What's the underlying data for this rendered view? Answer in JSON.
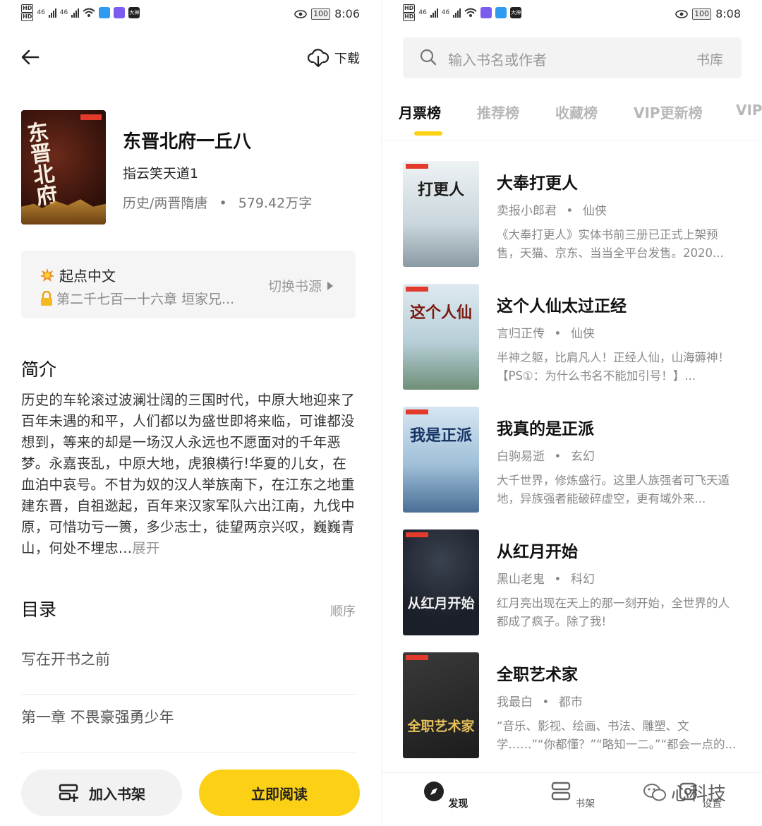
{
  "status_left": {
    "hd1": "HD",
    "hd2": "HD",
    "net1": "46",
    "net2": "46",
    "app_tag": "大神"
  },
  "status_right_left": {
    "battery": "100",
    "time": "8:06"
  },
  "status_right_right": {
    "battery": "100",
    "time": "8:08"
  },
  "detail": {
    "download_label": "下载",
    "cover_title": "东晋北府",
    "book_title": "东晋北府一丘八",
    "author": "指云笑天道1",
    "category": "历史/两晋隋唐",
    "separator": "•",
    "word_count": "579.42万字",
    "source": {
      "name": "起点中文",
      "chapter": "第二千七百一十六章 垣家兄...",
      "switch_label": "切换书源"
    },
    "intro_heading": "简介",
    "intro_text": "历史的车轮滚过波澜壮阔的三国时代，中原大地迎来了百年未遇的和平，人们都以为盛世即将来临，可谁都没想到，等来的却是一场汉人永远也不愿面对的千年恶梦。永嘉丧乱，中原大地，虎狼横行!华夏的儿女，在血泊中哀号。不甘为奴的汉人举族南下，在江东之地重建东晋，自祖逖起，百年来汉家军队六出江南，九伐中原，可惜功亏一篑，多少志士，徒望两京兴叹，巍巍青山，何处不埋忠...",
    "intro_more": "展开",
    "toc_heading": "目录",
    "toc_order": "顺序",
    "toc_items": [
      "写在开书之前",
      "第一章 不畏豪强勇少年"
    ],
    "add_shelf_label": "加入书架",
    "read_now_label": "立即阅读"
  },
  "discover": {
    "search_placeholder": "输入书名或作者",
    "library_label": "书库",
    "tabs": [
      "月票榜",
      "推荐榜",
      "收藏榜",
      "VIP更新榜",
      "VIP"
    ],
    "active_tab": "月票榜",
    "books": [
      {
        "cover_text": "打更人",
        "title": "大奉打更人",
        "author": "卖报小郎君",
        "genre": "仙侠",
        "desc": "《大奉打更人》实体书前三册已正式上架预售，天猫、京东、当当全平台发售。2020...",
        "cover_bg": "#dfe7ec",
        "cover_fg": "#1b1b1b"
      },
      {
        "cover_text": "这个人仙",
        "title": "这个人仙太过正经",
        "author": "言归正传",
        "genre": "仙侠",
        "desc": "半神之躯，比肩凡人！正经人仙，山海薅神！【PS①：为什么书名不能加引号！】...",
        "cover_bg": "#cfe0e8",
        "cover_fg": "#8a1a12"
      },
      {
        "cover_text": "我是正派",
        "title": "我真的是正派",
        "author": "白驹易逝",
        "genre": "玄幻",
        "desc": "大千世界，修炼盛行。这里人族强者可飞天遁地，异族强者能破碎虚空，更有域外来...",
        "cover_bg": "#b9d3e6",
        "cover_fg": "#183a6e"
      },
      {
        "cover_text": "从红月开始",
        "title": "从红月开始",
        "author": "黑山老鬼",
        "genre": "科幻",
        "desc": "红月亮出现在天上的那一刻开始，全世界的人都成了疯子。除了我!",
        "cover_bg": "#1e2430",
        "cover_fg": "#f2f2f2"
      },
      {
        "cover_text": "全职艺术家",
        "title": "全职艺术家",
        "author": "我最白",
        "genre": "都市",
        "desc": "“音乐、影视、绘画、书法、雕塑、文学……”“你都懂？”“略知一二。”“都会一点的...",
        "cover_bg": "#2b2b2b",
        "cover_fg": "#e8c15a"
      }
    ],
    "nav": [
      "发现",
      "书架",
      "设置"
    ],
    "watermark": "心科技"
  },
  "colors": {
    "accent": "#fcd014",
    "muted": "#999999",
    "title": "#111111"
  },
  "icons": [
    "back-arrow-icon",
    "download-icon",
    "fire-icon",
    "lock-icon",
    "chevron-right-icon",
    "bookshelf-add-icon",
    "search-icon",
    "compass-icon",
    "bookshelf-icon",
    "settings-icon",
    "wechat-icon"
  ]
}
